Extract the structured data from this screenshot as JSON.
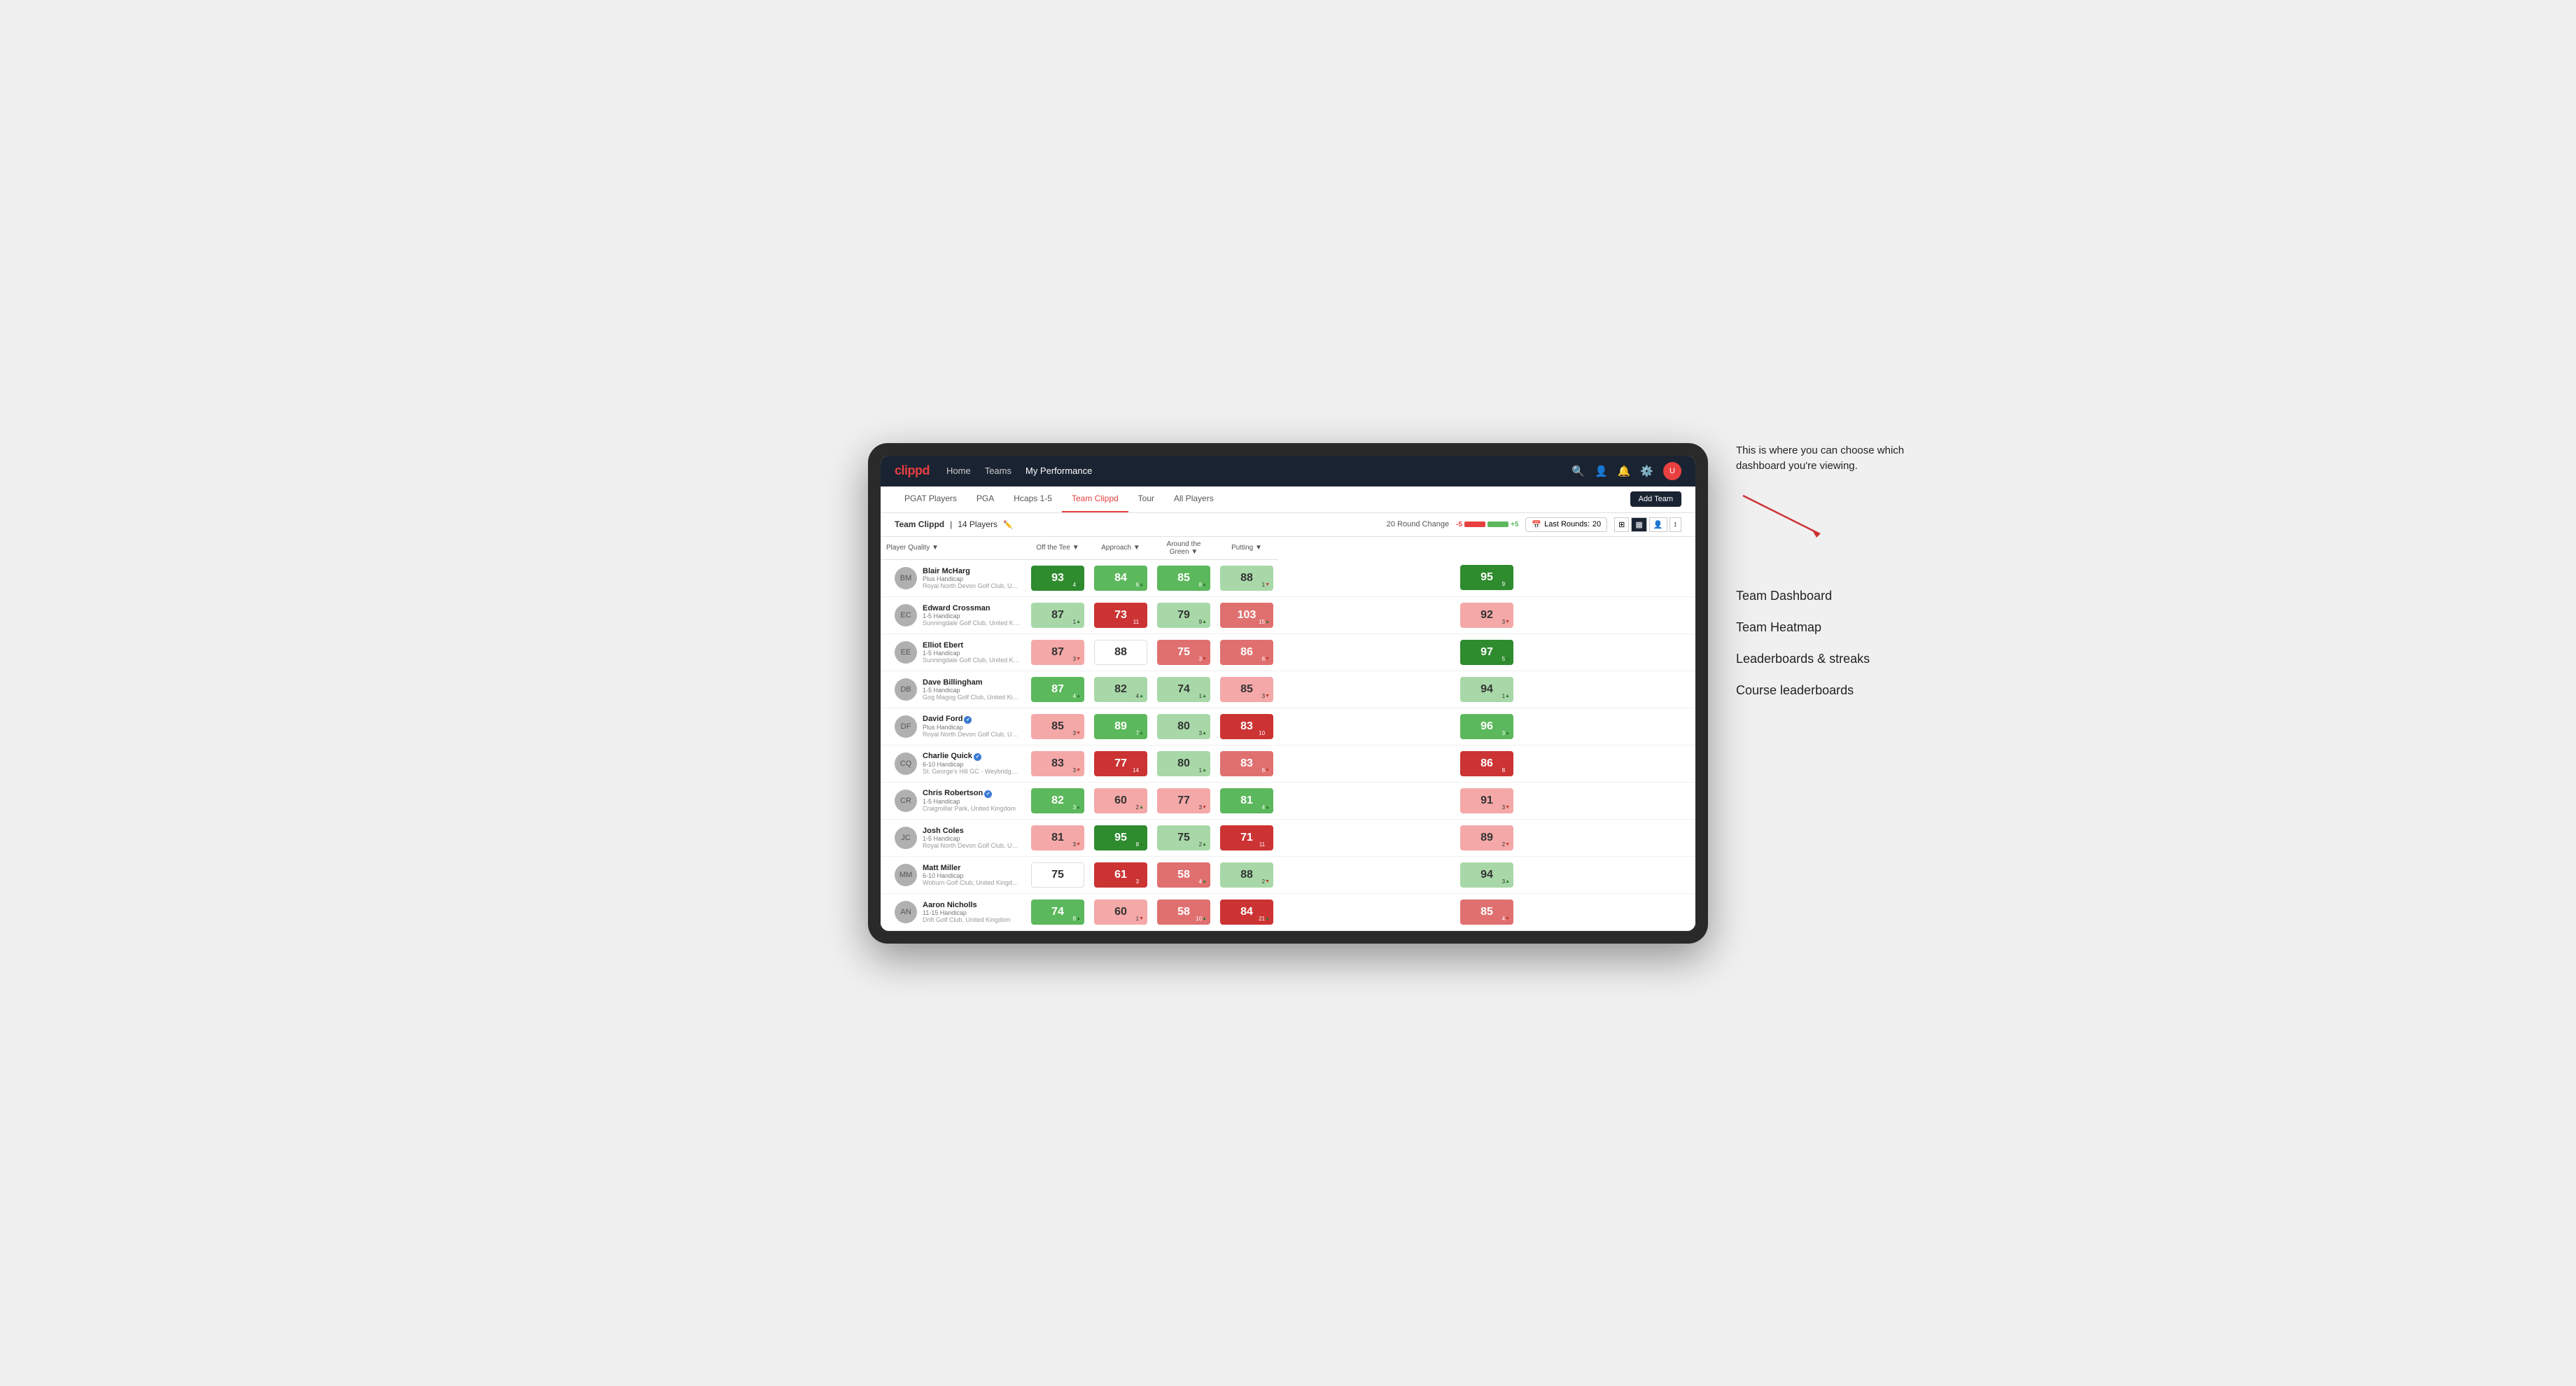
{
  "annotation": {
    "callout": "This is where you can choose which dashboard you're viewing.",
    "items": [
      "Team Dashboard",
      "Team Heatmap",
      "Leaderboards & streaks",
      "Course leaderboards"
    ]
  },
  "nav": {
    "logo": "clippd",
    "links": [
      {
        "label": "Home",
        "active": false
      },
      {
        "label": "Teams",
        "active": false
      },
      {
        "label": "My Performance",
        "active": true
      }
    ],
    "icons": [
      "search",
      "user",
      "bell",
      "settings",
      "avatar"
    ]
  },
  "sub_nav": {
    "links": [
      {
        "label": "PGAT Players",
        "active": false
      },
      {
        "label": "PGA",
        "active": false
      },
      {
        "label": "Hcaps 1-5",
        "active": false
      },
      {
        "label": "Team Clippd",
        "active": true
      },
      {
        "label": "Tour",
        "active": false
      },
      {
        "label": "All Players",
        "active": false
      }
    ],
    "add_team_label": "Add Team"
  },
  "team_header": {
    "name": "Team Clippd",
    "player_count": "14 Players",
    "round_change_label": "20 Round Change",
    "scale_min": "-5",
    "scale_max": "+5",
    "last_rounds_label": "Last Rounds:",
    "last_rounds_value": "20"
  },
  "table": {
    "columns": [
      {
        "label": "Player Quality ▼",
        "key": "player_quality"
      },
      {
        "label": "Off the Tee ▼",
        "key": "off_tee"
      },
      {
        "label": "Approach ▼",
        "key": "approach"
      },
      {
        "label": "Around the Green ▼",
        "key": "around_green"
      },
      {
        "label": "Putting ▼",
        "key": "putting"
      }
    ],
    "rows": [
      {
        "name": "Blair McHarg",
        "handicap": "Plus Handicap",
        "club": "Royal North Devon Golf Club, United Kingdom",
        "initials": "BM",
        "verified": false,
        "player_quality": {
          "value": 93,
          "change": 4,
          "dir": "up",
          "color": "green-strong"
        },
        "off_tee": {
          "value": 84,
          "change": 6,
          "dir": "up",
          "color": "green-medium"
        },
        "approach": {
          "value": 85,
          "change": 8,
          "dir": "up",
          "color": "green-medium"
        },
        "around_green": {
          "value": 88,
          "change": 1,
          "dir": "down",
          "color": "green-light"
        },
        "putting": {
          "value": 95,
          "change": 9,
          "dir": "up",
          "color": "green-strong"
        }
      },
      {
        "name": "Edward Crossman",
        "handicap": "1-5 Handicap",
        "club": "Sunningdale Golf Club, United Kingdom",
        "initials": "EC",
        "verified": false,
        "player_quality": {
          "value": 87,
          "change": 1,
          "dir": "up",
          "color": "green-light"
        },
        "off_tee": {
          "value": 73,
          "change": 11,
          "dir": "down",
          "color": "red-strong"
        },
        "approach": {
          "value": 79,
          "change": 9,
          "dir": "up",
          "color": "green-light"
        },
        "around_green": {
          "value": 103,
          "change": 15,
          "dir": "up",
          "color": "red-medium"
        },
        "putting": {
          "value": 92,
          "change": 3,
          "dir": "down",
          "color": "red-light"
        }
      },
      {
        "name": "Elliot Ebert",
        "handicap": "1-5 Handicap",
        "club": "Sunningdale Golf Club, United Kingdom",
        "initials": "EE",
        "verified": false,
        "player_quality": {
          "value": 87,
          "change": 3,
          "dir": "down",
          "color": "red-light"
        },
        "off_tee": {
          "value": 88,
          "change": null,
          "dir": null,
          "color": "white"
        },
        "approach": {
          "value": 75,
          "change": 3,
          "dir": "down",
          "color": "red-medium"
        },
        "around_green": {
          "value": 86,
          "change": 6,
          "dir": "down",
          "color": "red-medium"
        },
        "putting": {
          "value": 97,
          "change": 5,
          "dir": "up",
          "color": "green-strong"
        }
      },
      {
        "name": "Dave Billingham",
        "handicap": "1-5 Handicap",
        "club": "Gog Magog Golf Club, United Kingdom",
        "initials": "DB",
        "verified": false,
        "player_quality": {
          "value": 87,
          "change": 4,
          "dir": "up",
          "color": "green-medium"
        },
        "off_tee": {
          "value": 82,
          "change": 4,
          "dir": "up",
          "color": "green-light"
        },
        "approach": {
          "value": 74,
          "change": 1,
          "dir": "up",
          "color": "green-light"
        },
        "around_green": {
          "value": 85,
          "change": 3,
          "dir": "down",
          "color": "red-light"
        },
        "putting": {
          "value": 94,
          "change": 1,
          "dir": "up",
          "color": "green-light"
        }
      },
      {
        "name": "David Ford",
        "handicap": "Plus Handicap",
        "club": "Royal North Devon Golf Club, United Kingdom",
        "initials": "DF",
        "verified": true,
        "player_quality": {
          "value": 85,
          "change": 3,
          "dir": "down",
          "color": "red-light"
        },
        "off_tee": {
          "value": 89,
          "change": 7,
          "dir": "up",
          "color": "green-medium"
        },
        "approach": {
          "value": 80,
          "change": 3,
          "dir": "up",
          "color": "green-light"
        },
        "around_green": {
          "value": 83,
          "change": 10,
          "dir": "down",
          "color": "red-strong"
        },
        "putting": {
          "value": 96,
          "change": 3,
          "dir": "up",
          "color": "green-medium"
        }
      },
      {
        "name": "Charlie Quick",
        "handicap": "6-10 Handicap",
        "club": "St. George's Hill GC - Weybridge - Surrey, Uni...",
        "initials": "CQ",
        "verified": true,
        "player_quality": {
          "value": 83,
          "change": 3,
          "dir": "down",
          "color": "red-light"
        },
        "off_tee": {
          "value": 77,
          "change": 14,
          "dir": "down",
          "color": "red-strong"
        },
        "approach": {
          "value": 80,
          "change": 1,
          "dir": "up",
          "color": "green-light"
        },
        "around_green": {
          "value": 83,
          "change": 6,
          "dir": "down",
          "color": "red-medium"
        },
        "putting": {
          "value": 86,
          "change": 8,
          "dir": "down",
          "color": "red-strong"
        }
      },
      {
        "name": "Chris Robertson",
        "handicap": "1-5 Handicap",
        "club": "Craigmillar Park, United Kingdom",
        "initials": "CR",
        "verified": true,
        "player_quality": {
          "value": 82,
          "change": 3,
          "dir": "up",
          "color": "green-medium"
        },
        "off_tee": {
          "value": 60,
          "change": 2,
          "dir": "up",
          "color": "red-light"
        },
        "approach": {
          "value": 77,
          "change": 3,
          "dir": "down",
          "color": "red-light"
        },
        "around_green": {
          "value": 81,
          "change": 4,
          "dir": "up",
          "color": "green-medium"
        },
        "putting": {
          "value": 91,
          "change": 3,
          "dir": "down",
          "color": "red-light"
        }
      },
      {
        "name": "Josh Coles",
        "handicap": "1-5 Handicap",
        "club": "Royal North Devon Golf Club, United Kingdom",
        "initials": "JC",
        "verified": false,
        "player_quality": {
          "value": 81,
          "change": 3,
          "dir": "down",
          "color": "red-light"
        },
        "off_tee": {
          "value": 95,
          "change": 8,
          "dir": "up",
          "color": "green-strong"
        },
        "approach": {
          "value": 75,
          "change": 2,
          "dir": "up",
          "color": "green-light"
        },
        "around_green": {
          "value": 71,
          "change": 11,
          "dir": "down",
          "color": "red-strong"
        },
        "putting": {
          "value": 89,
          "change": 2,
          "dir": "down",
          "color": "red-light"
        }
      },
      {
        "name": "Matt Miller",
        "handicap": "6-10 Handicap",
        "club": "Woburn Golf Club, United Kingdom",
        "initials": "MM",
        "verified": false,
        "player_quality": {
          "value": 75,
          "change": null,
          "dir": null,
          "color": "white"
        },
        "off_tee": {
          "value": 61,
          "change": 3,
          "dir": "down",
          "color": "red-strong"
        },
        "approach": {
          "value": 58,
          "change": 4,
          "dir": "up",
          "color": "red-medium"
        },
        "around_green": {
          "value": 88,
          "change": 2,
          "dir": "down",
          "color": "green-light"
        },
        "putting": {
          "value": 94,
          "change": 3,
          "dir": "up",
          "color": "green-light"
        }
      },
      {
        "name": "Aaron Nicholls",
        "handicap": "11-15 Handicap",
        "club": "Drift Golf Club, United Kingdom",
        "initials": "AN",
        "verified": false,
        "player_quality": {
          "value": 74,
          "change": 8,
          "dir": "up",
          "color": "green-medium"
        },
        "off_tee": {
          "value": 60,
          "change": 1,
          "dir": "down",
          "color": "red-light"
        },
        "approach": {
          "value": 58,
          "change": 10,
          "dir": "up",
          "color": "red-medium"
        },
        "around_green": {
          "value": 84,
          "change": 21,
          "dir": "up",
          "color": "red-strong"
        },
        "putting": {
          "value": 85,
          "change": 4,
          "dir": "down",
          "color": "red-medium"
        }
      }
    ]
  },
  "colors": {
    "green_strong": "#2e8b2e",
    "green_medium": "#5cb85c",
    "green_light": "#a8d8a8",
    "white": "#ffffff",
    "red_light": "#f5a8a8",
    "red_medium": "#e07070",
    "red_strong": "#cc3333",
    "nav_bg": "#1a2332",
    "accent_red": "#e84040"
  }
}
